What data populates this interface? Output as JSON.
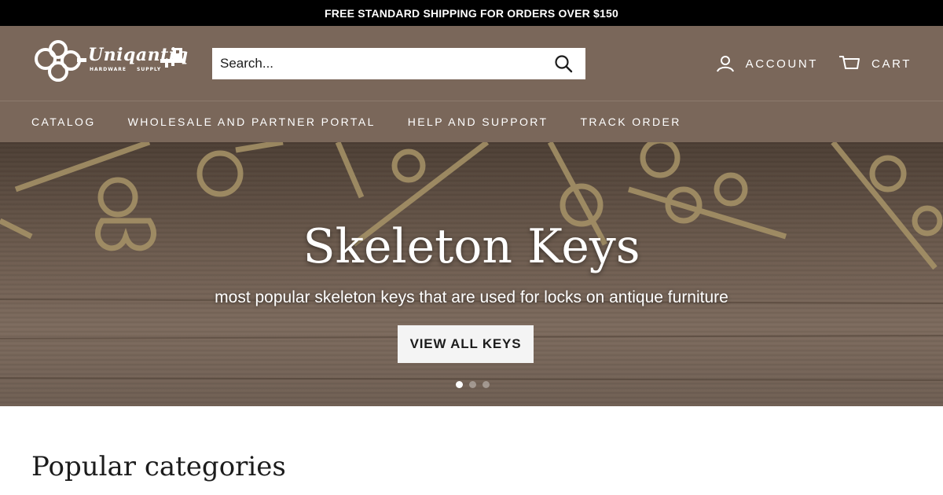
{
  "announcement": {
    "text": "FREE STANDARD SHIPPING FOR ORDERS OVER $150"
  },
  "header": {
    "logo": {
      "icon": "skeleton-key-logo",
      "name": "Uniqantiq",
      "sub_left": "HARDWARE",
      "sub_right": "SUPPLY"
    },
    "search": {
      "placeholder": "Search...",
      "icon": "search-icon"
    },
    "account": {
      "label": "ACCOUNT",
      "icon": "user-icon"
    },
    "cart": {
      "label": "CART",
      "icon": "cart-icon"
    }
  },
  "nav": {
    "items": [
      {
        "label": "CATALOG"
      },
      {
        "label": "WHOLESALE AND PARTNER PORTAL"
      },
      {
        "label": "HELP AND SUPPORT"
      },
      {
        "label": "TRACK ORDER"
      }
    ]
  },
  "hero": {
    "title": "Skeleton Keys",
    "subtitle": "most popular skeleton keys that are used for locks on antique furniture",
    "button_label": "VIEW ALL KEYS",
    "slides_total": 3,
    "active_slide": 1
  },
  "sections": {
    "popular_title": "Popular categories"
  },
  "colors": {
    "announcement_bg": "#000000",
    "header_bg": "#7a675a",
    "button_bg": "#f4f4f4",
    "text_dark": "#1c1c1c"
  }
}
